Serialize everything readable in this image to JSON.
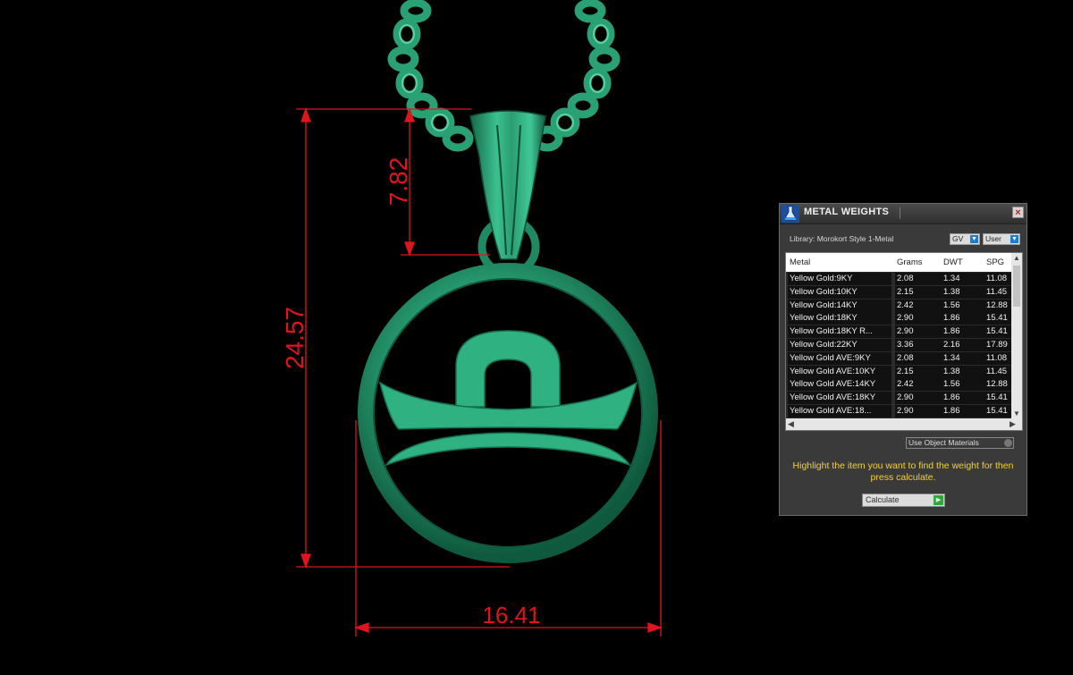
{
  "dimensions": {
    "height_total": "24.57",
    "bail_height": "7.82",
    "width": "16.41"
  },
  "panel": {
    "title": "METAL WEIGHTS",
    "close_label": "×",
    "library_label": "Library: Morokort Style 1-Metal",
    "dropdown_gv": "GV",
    "dropdown_user": "User",
    "columns": [
      "Metal",
      "Grams",
      "DWT",
      "SPG"
    ],
    "rows": [
      {
        "metal": "Yellow Gold:9KY",
        "grams": "2.08",
        "dwt": "1.34",
        "spg": "11.08"
      },
      {
        "metal": "Yellow Gold:10KY",
        "grams": "2.15",
        "dwt": "1.38",
        "spg": "11.45"
      },
      {
        "metal": "Yellow Gold:14KY",
        "grams": "2.42",
        "dwt": "1.56",
        "spg": "12.88"
      },
      {
        "metal": "Yellow Gold:18KY",
        "grams": "2.90",
        "dwt": "1.86",
        "spg": "15.41"
      },
      {
        "metal": "Yellow Gold:18KY R...",
        "grams": "2.90",
        "dwt": "1.86",
        "spg": "15.41"
      },
      {
        "metal": "Yellow Gold:22KY",
        "grams": "3.36",
        "dwt": "2.16",
        "spg": "17.89"
      },
      {
        "metal": "Yellow Gold AVE:9KY",
        "grams": "2.08",
        "dwt": "1.34",
        "spg": "11.08"
      },
      {
        "metal": "Yellow Gold AVE:10KY",
        "grams": "2.15",
        "dwt": "1.38",
        "spg": "11.45"
      },
      {
        "metal": "Yellow Gold AVE:14KY",
        "grams": "2.42",
        "dwt": "1.56",
        "spg": "12.88"
      },
      {
        "metal": "Yellow Gold AVE:18KY",
        "grams": "2.90",
        "dwt": "1.86",
        "spg": "15.41"
      },
      {
        "metal": "Yellow Gold AVE:18...",
        "grams": "2.90",
        "dwt": "1.86",
        "spg": "15.41"
      }
    ],
    "use_object_materials": "Use Object Materials",
    "hint": "Highlight the item you want to find the weight for then press calculate.",
    "calculate_label": "Calculate"
  },
  "colors": {
    "dimension": "#e0141e",
    "pendant": "#2fa779",
    "hint": "#f4d22a"
  },
  "icons": {
    "app": "flask-icon",
    "close": "close-icon",
    "calculate": "play-arrow-icon"
  }
}
